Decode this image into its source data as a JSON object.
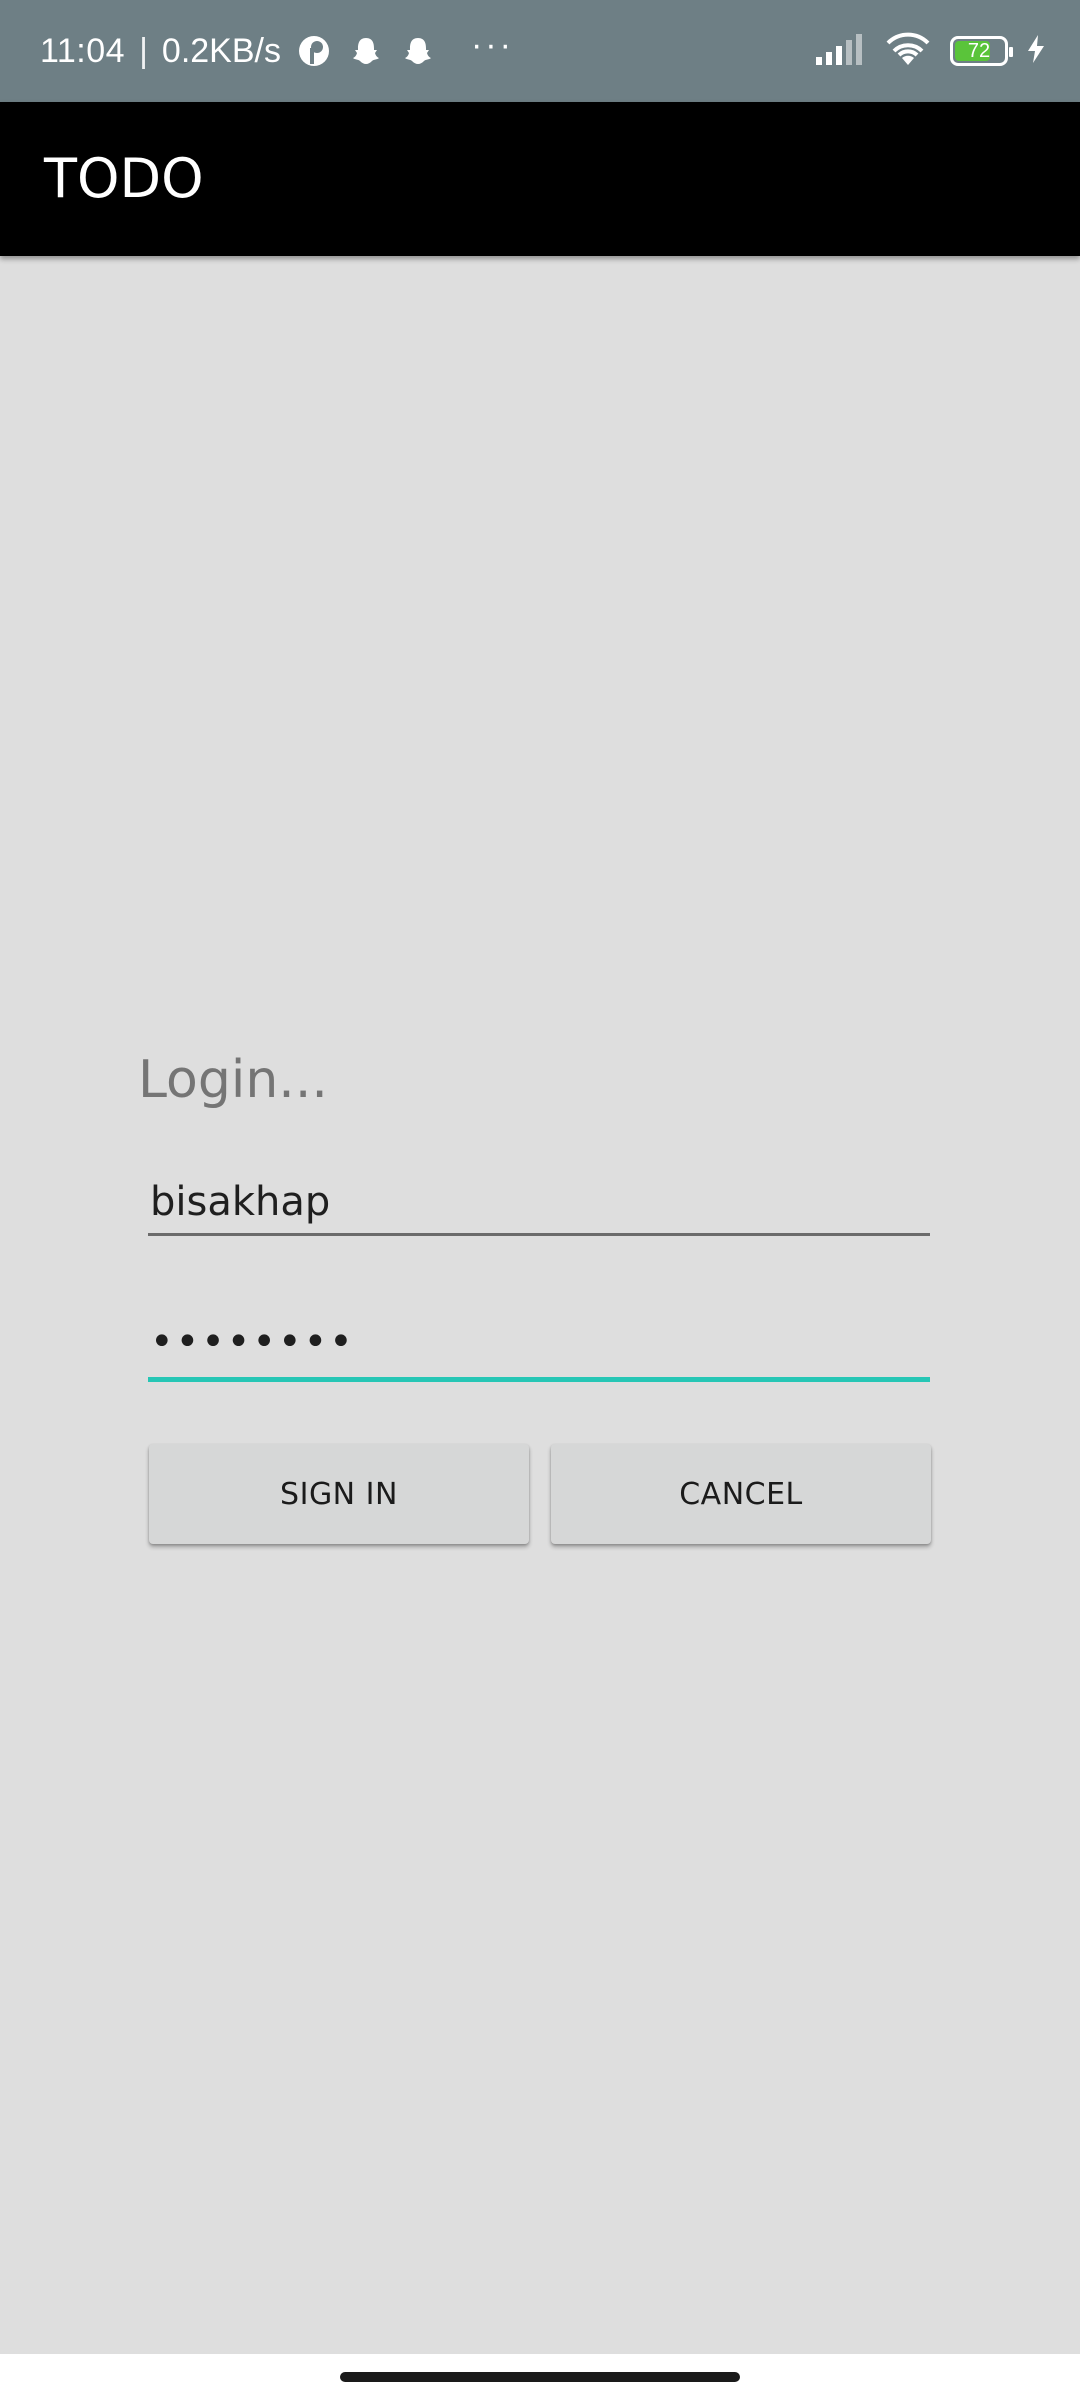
{
  "status_bar": {
    "time": "11:04",
    "separator": "|",
    "network_speed": "0.2KB/s",
    "notification_icons": [
      "pinterest-like-icon",
      "snapchat-icon",
      "snapchat-icon"
    ],
    "overflow": "···",
    "signal_icon": "cellular-signal-icon",
    "wifi_icon": "wifi-icon",
    "battery_level": "72",
    "battery_fraction": 0.72,
    "charging_icon": "bolt-icon",
    "colors": {
      "background": "#6e7f85",
      "battery_fill": "#5ac43a"
    }
  },
  "app_bar": {
    "title": "TODO",
    "background": "#000000"
  },
  "login": {
    "heading": "Login...",
    "username_value": "bisakhap",
    "password_value": "••••••••",
    "accent_color": "#26c6b5",
    "signin_label": "SIGN IN",
    "cancel_label": "CANCEL"
  }
}
